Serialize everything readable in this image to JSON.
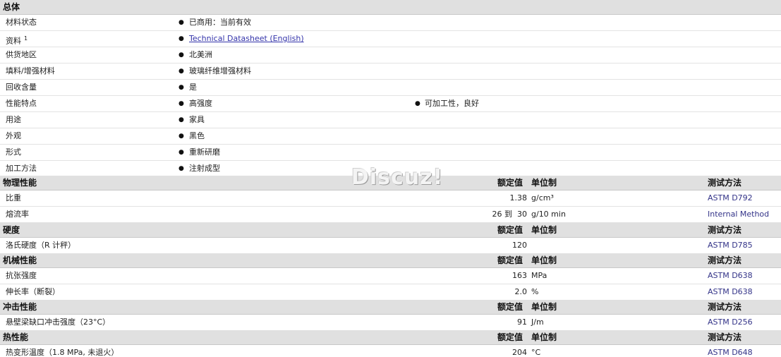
{
  "overview": {
    "title": "总体",
    "rows": [
      {
        "label": "材料状态",
        "values": [
          "已商用：当前有效"
        ]
      },
      {
        "label": "资料",
        "sup": "1",
        "link": "Technical Datasheet (English)"
      },
      {
        "label": "供货地区",
        "values": [
          "北美洲"
        ]
      },
      {
        "label": "填料/增强材料",
        "values": [
          "玻璃纤维增强材料"
        ]
      },
      {
        "label": "回收含量",
        "values": [
          "是"
        ]
      },
      {
        "label": "性能特点",
        "values": [
          "高强度",
          "可加工性，良好"
        ]
      },
      {
        "label": "用途",
        "values": [
          "家具"
        ]
      },
      {
        "label": "外观",
        "values": [
          "黑色"
        ]
      },
      {
        "label": "形式",
        "values": [
          "重新研磨"
        ]
      },
      {
        "label": "加工方法",
        "values": [
          "注射成型"
        ]
      }
    ]
  },
  "watermark": "Discuz!",
  "columns": {
    "nominal": "额定值",
    "unit": "单位制",
    "method": "测试方法"
  },
  "sections": [
    {
      "title": "物理性能",
      "rows": [
        {
          "label": "比重",
          "value": "1.38",
          "unit": "g/cm³",
          "method": "ASTM D792"
        },
        {
          "label": "熔流率",
          "value": "26 到  30",
          "unit": "g/10 min",
          "method": "Internal Method"
        }
      ]
    },
    {
      "title": "硬度",
      "rows": [
        {
          "label": "洛氏硬度（R 计秤）",
          "value": "120",
          "unit": "",
          "method": "ASTM D785"
        }
      ]
    },
    {
      "title": "机械性能",
      "rows": [
        {
          "label": "抗张强度",
          "value": "163",
          "unit": "MPa",
          "method": "ASTM D638"
        },
        {
          "label": "伸长率（断裂）",
          "value": "2.0",
          "unit": "%",
          "method": "ASTM D638"
        }
      ]
    },
    {
      "title": "冲击性能",
      "rows": [
        {
          "label": "悬壁梁缺口冲击强度（23°C）",
          "value": "91",
          "unit": "J/m",
          "method": "ASTM D256"
        }
      ]
    },
    {
      "title": "热性能",
      "rows": [
        {
          "label": "热变形温度（1.8 MPa, 未退火）",
          "value": "204",
          "unit": "°C",
          "method": "ASTM D648"
        }
      ]
    }
  ]
}
